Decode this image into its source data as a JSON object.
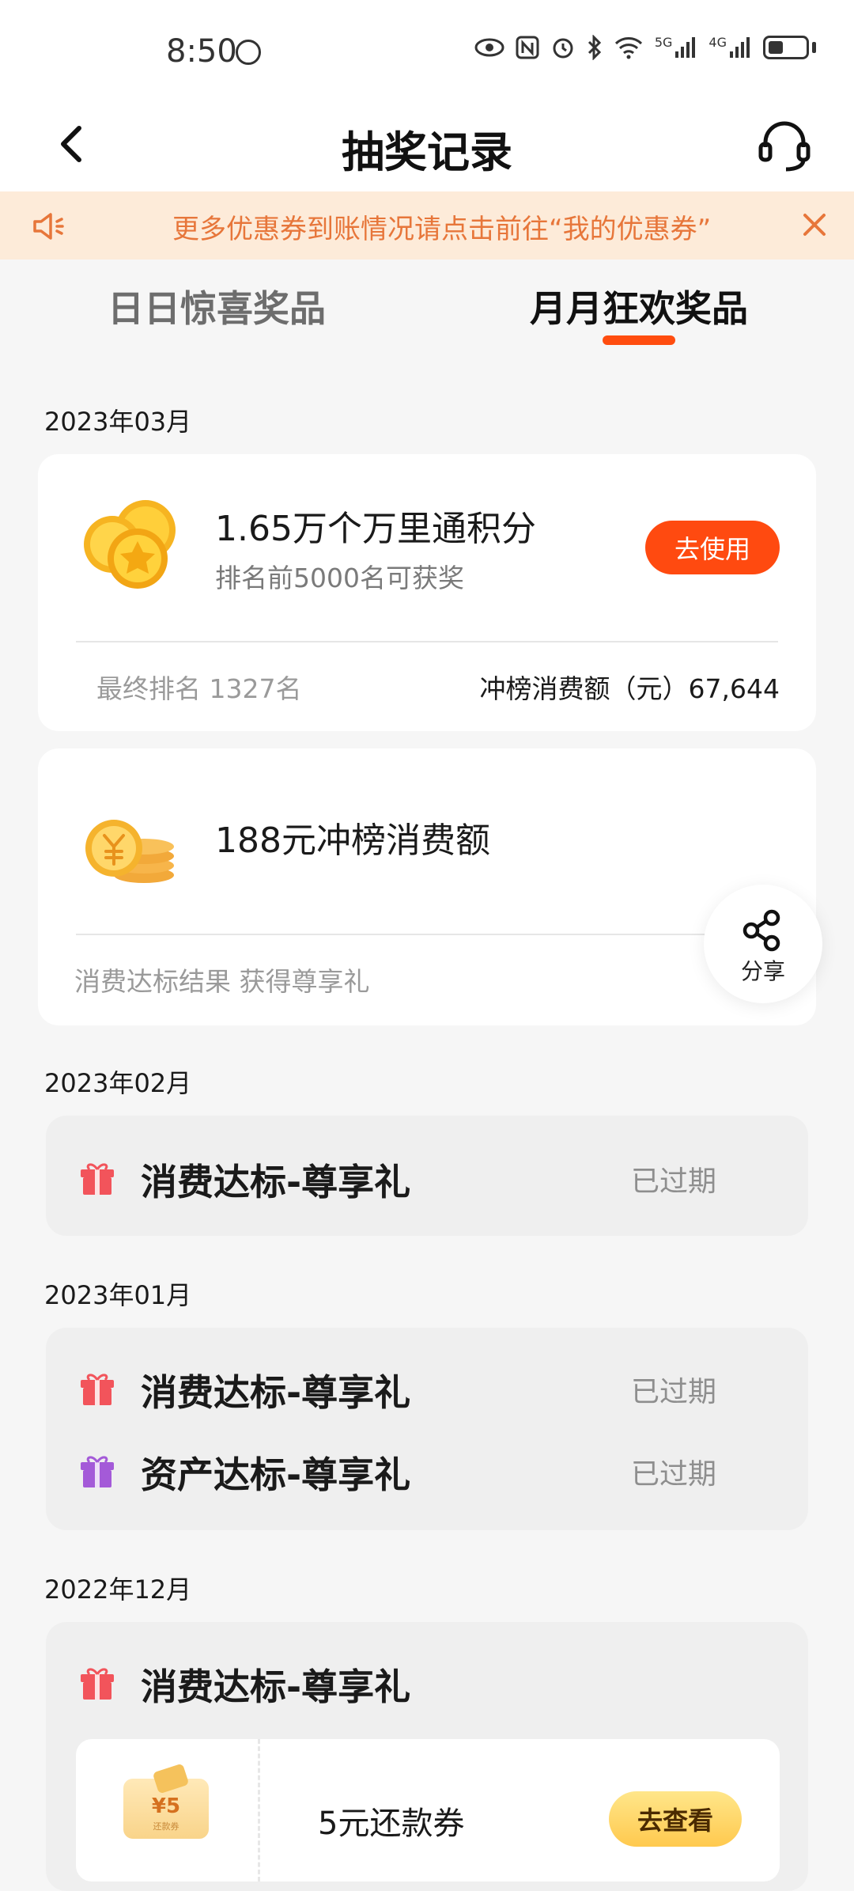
{
  "status_bar": {
    "time": "8:50",
    "icons": [
      "eye-icon",
      "nfc-icon",
      "alarm-icon",
      "bluetooth-icon",
      "wifi-icon",
      "signal-5g-icon",
      "signal-4g-icon",
      "battery-icon"
    ],
    "net1": "5G",
    "net2": "4G"
  },
  "header": {
    "title": "抽奖记录"
  },
  "notice": {
    "text": "更多优惠券到账情况请点击前往“我的优惠券”"
  },
  "tabs": [
    {
      "label": "日日惊喜奖品",
      "active": false
    },
    {
      "label": "月月狂欢奖品",
      "active": true
    }
  ],
  "sections": {
    "m2023_03": {
      "month": "2023年03月",
      "prize1": {
        "title": "1.65万个万里通积分",
        "subtitle": "排名前5000名可获奖",
        "button": "去使用",
        "rank_label": "最终排名 1327名",
        "amount_label": "冲榜消费额（元）67,644"
      },
      "prize2": {
        "title": "188元冲榜消费额",
        "footer": "消费达标结果 获得尊享礼"
      }
    },
    "m2023_02": {
      "month": "2023年02月",
      "items": [
        {
          "name": "消费达标-尊享礼",
          "status": "已过期",
          "icon_color": "#f2545b"
        }
      ]
    },
    "m2023_01": {
      "month": "2023年01月",
      "items": [
        {
          "name": "消费达标-尊享礼",
          "status": "已过期",
          "icon_color": "#f2545b"
        },
        {
          "name": "资产达标-尊享礼",
          "status": "已过期",
          "icon_color": "#a45ad8"
        }
      ]
    },
    "m2022_12": {
      "month": "2022年12月",
      "items": [
        {
          "name": "消费达标-尊享礼",
          "icon_color": "#f2545b"
        }
      ],
      "voucher": {
        "badge": "¥5",
        "badge_sub": "还款券",
        "name": "5元还款券",
        "button": "去查看"
      }
    }
  },
  "share": {
    "label": "分享"
  },
  "colors": {
    "accent": "#ff4a10",
    "notice_text": "#e7763a",
    "notice_bg": "#fdebd9"
  }
}
